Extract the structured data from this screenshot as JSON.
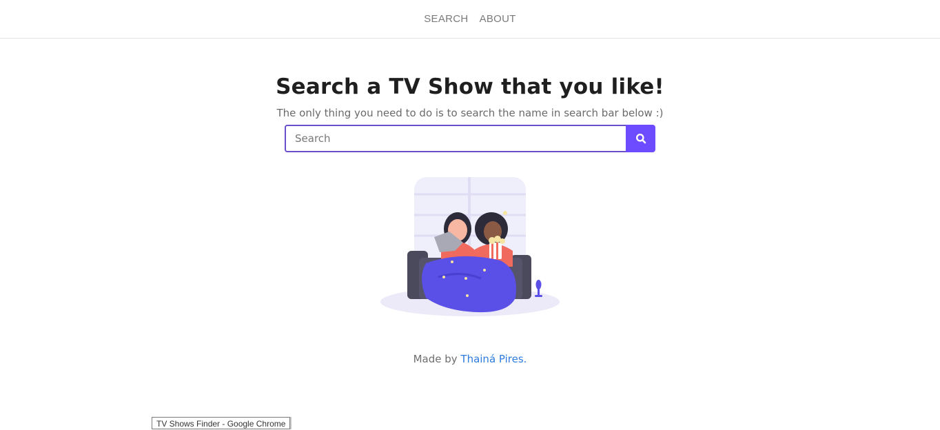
{
  "nav": {
    "items": [
      {
        "label": "SEARCH"
      },
      {
        "label": "ABOUT"
      }
    ]
  },
  "hero": {
    "title": "Search a TV Show that you like!",
    "subtitle": "The only thing you need to do is to search the name in search bar below :)"
  },
  "search": {
    "placeholder": "Search",
    "value": "",
    "button_icon": "search-icon"
  },
  "illustration": {
    "icon": "people-watching-tv-illustration"
  },
  "footer": {
    "made_by_prefix": "Made by",
    "author_name": "Thainá Pires."
  },
  "tooltip": {
    "text": "TV Shows Finder - Google Chrome"
  },
  "colors": {
    "accent": "#6d4cff",
    "input_border": "#6b4fc9",
    "link": "#2d7be0",
    "title": "#1f1f1f",
    "muted": "#6a6a6a"
  }
}
